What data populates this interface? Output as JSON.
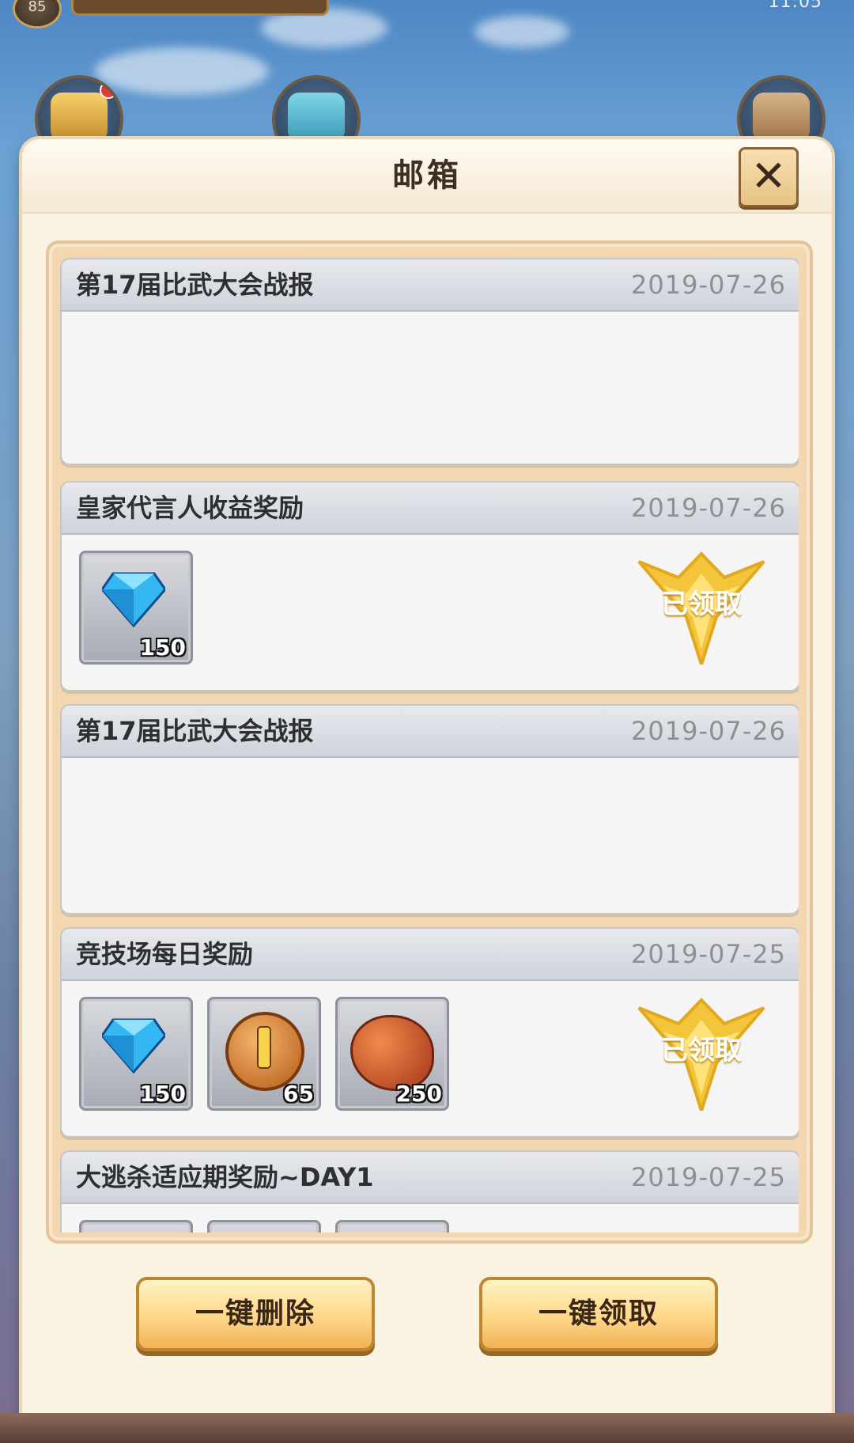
{
  "status": {
    "level": "85",
    "clock": "11:05"
  },
  "dialog": {
    "title": "邮箱"
  },
  "mails": [
    {
      "title": "第17届比武大会战报",
      "date": "2019-07-26",
      "rewards": [],
      "claimed_label": ""
    },
    {
      "title": "皇家代言人收益奖励",
      "date": "2019-07-26",
      "rewards": [
        {
          "icon": "diamond-icon",
          "qty": "150"
        }
      ],
      "claimed_label": "已领取"
    },
    {
      "title": "第17届比武大会战报",
      "date": "2019-07-26",
      "rewards": [],
      "claimed_label": ""
    },
    {
      "title": "竞技场每日奖励",
      "date": "2019-07-25",
      "rewards": [
        {
          "icon": "diamond-icon",
          "qty": "150"
        },
        {
          "icon": "gold-coin-icon",
          "qty": "65"
        },
        {
          "icon": "ore-icon",
          "qty": "250"
        }
      ],
      "claimed_label": "已领取"
    },
    {
      "title": "大逃杀适应期奖励~DAY1",
      "date": "2019-07-25",
      "rewards": [],
      "claimed_label": ""
    }
  ],
  "actions": {
    "delete_all": "一键删除",
    "claim_all": "一键领取"
  },
  "colors": {
    "panel": "#fbf3e2",
    "button": "#ffd788",
    "claimed_badge": "#f3c53a",
    "frame": "#f2d7b0"
  }
}
